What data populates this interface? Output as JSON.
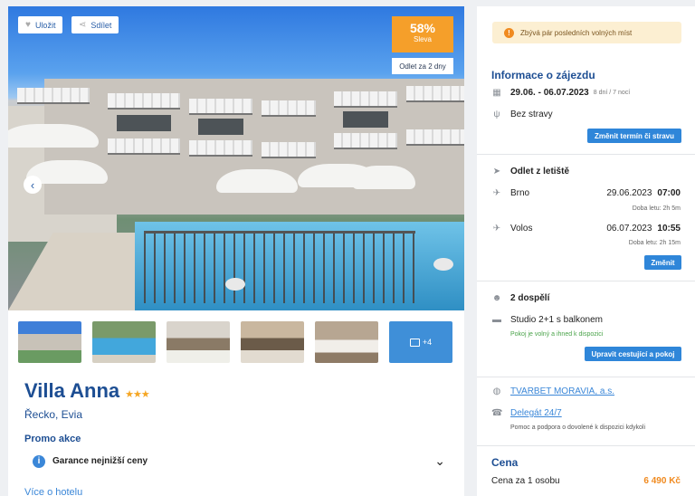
{
  "gallery": {
    "save_label": "Uložit",
    "share_label": "Sdílet",
    "discount_percent": "58%",
    "discount_label": "Sleva",
    "departure_badge": "Odlet za 2 dny",
    "more_photos": "+4"
  },
  "hotel": {
    "name": "Villa Anna",
    "stars": "★★★",
    "location": "Řecko, Evia",
    "promo_title": "Promo akce",
    "guarantee": "Garance nejnižší ceny",
    "more_link": "Více o hotelu"
  },
  "sidebar": {
    "warning": "Zbývá pár posledních volných míst",
    "info_title": "Informace o zájezdu",
    "dates": "29.06. - 06.07.2023",
    "duration": "8 dní / 7 nocí",
    "board": "Bez stravy",
    "change_date_button": "Změnit termín či stravu",
    "departure_title": "Odlet z letiště",
    "outbound": {
      "city": "Brno",
      "date": "29.06.2023",
      "time": "07:00",
      "flight_time": "Doba letu: 2h 5m"
    },
    "return": {
      "city": "Volos",
      "date": "06.07.2023",
      "time": "10:55",
      "flight_time": "Doba letu: 2h 15m"
    },
    "change_button": "Změnit",
    "travellers": "2 dospělí",
    "room": "Studio 2+1 s balkonem",
    "room_availability": "Pokoj je volný a ihned k dispozici",
    "edit_travellers_button": "Upravit cestující a pokoj",
    "agency": "TVARBET MORAVIA, a.s.",
    "delegate": "Delegát 24/7",
    "delegate_note": "Pomoc a podpora o dovolené k dispozici kdykoli",
    "price_title": "Cena",
    "price_per_person_label": "Cena za 1 osobu",
    "price_per_person": "6 490 Kč"
  },
  "colors": {
    "accent": "#2f86d9",
    "brand": "#1d4e93",
    "discount": "#f59f2a",
    "warning_bg": "#fcefd2"
  }
}
